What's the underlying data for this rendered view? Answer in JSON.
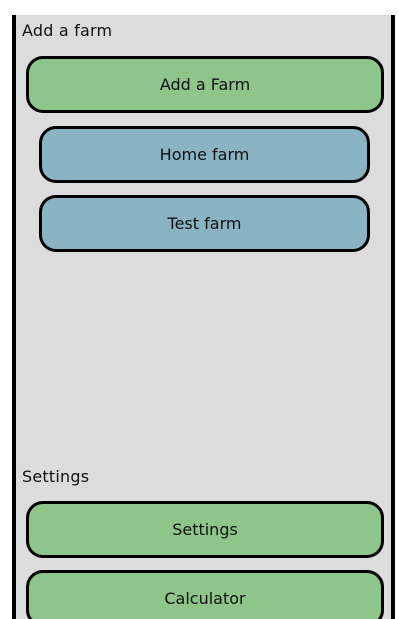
{
  "farms_section": {
    "label": "Add a farm",
    "add_button_label": "Add a Farm",
    "farms": [
      {
        "label": "Home farm"
      },
      {
        "label": "Test farm"
      }
    ]
  },
  "settings_section": {
    "label": "Settings",
    "settings_button_label": "Settings",
    "calculator_button_label": "Calculator"
  },
  "colors": {
    "panel_bg": "#dcdcdc",
    "green_button": "#8dc58a",
    "blue_button": "#8ab4c4",
    "border": "#000000"
  }
}
